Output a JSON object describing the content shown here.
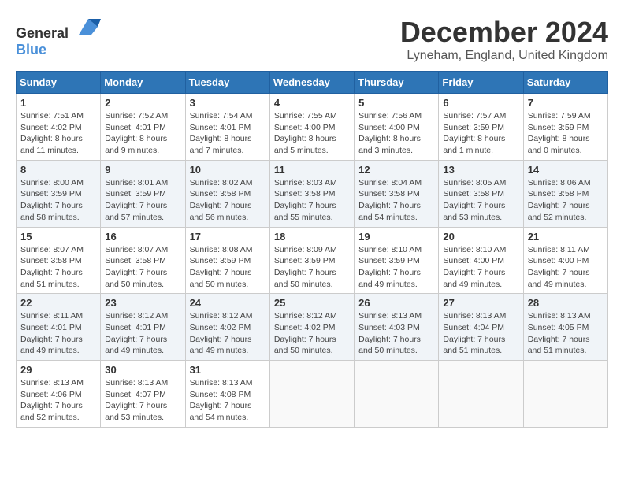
{
  "header": {
    "logo_general": "General",
    "logo_blue": "Blue",
    "month": "December 2024",
    "location": "Lyneham, England, United Kingdom"
  },
  "weekdays": [
    "Sunday",
    "Monday",
    "Tuesday",
    "Wednesday",
    "Thursday",
    "Friday",
    "Saturday"
  ],
  "weeks": [
    [
      {
        "day": "1",
        "sunrise": "7:51 AM",
        "sunset": "4:02 PM",
        "daylight": "8 hours and 11 minutes."
      },
      {
        "day": "2",
        "sunrise": "7:52 AM",
        "sunset": "4:01 PM",
        "daylight": "8 hours and 9 minutes."
      },
      {
        "day": "3",
        "sunrise": "7:54 AM",
        "sunset": "4:01 PM",
        "daylight": "8 hours and 7 minutes."
      },
      {
        "day": "4",
        "sunrise": "7:55 AM",
        "sunset": "4:00 PM",
        "daylight": "8 hours and 5 minutes."
      },
      {
        "day": "5",
        "sunrise": "7:56 AM",
        "sunset": "4:00 PM",
        "daylight": "8 hours and 3 minutes."
      },
      {
        "day": "6",
        "sunrise": "7:57 AM",
        "sunset": "3:59 PM",
        "daylight": "8 hours and 1 minute."
      },
      {
        "day": "7",
        "sunrise": "7:59 AM",
        "sunset": "3:59 PM",
        "daylight": "8 hours and 0 minutes."
      }
    ],
    [
      {
        "day": "8",
        "sunrise": "8:00 AM",
        "sunset": "3:59 PM",
        "daylight": "7 hours and 58 minutes."
      },
      {
        "day": "9",
        "sunrise": "8:01 AM",
        "sunset": "3:59 PM",
        "daylight": "7 hours and 57 minutes."
      },
      {
        "day": "10",
        "sunrise": "8:02 AM",
        "sunset": "3:58 PM",
        "daylight": "7 hours and 56 minutes."
      },
      {
        "day": "11",
        "sunrise": "8:03 AM",
        "sunset": "3:58 PM",
        "daylight": "7 hours and 55 minutes."
      },
      {
        "day": "12",
        "sunrise": "8:04 AM",
        "sunset": "3:58 PM",
        "daylight": "7 hours and 54 minutes."
      },
      {
        "day": "13",
        "sunrise": "8:05 AM",
        "sunset": "3:58 PM",
        "daylight": "7 hours and 53 minutes."
      },
      {
        "day": "14",
        "sunrise": "8:06 AM",
        "sunset": "3:58 PM",
        "daylight": "7 hours and 52 minutes."
      }
    ],
    [
      {
        "day": "15",
        "sunrise": "8:07 AM",
        "sunset": "3:58 PM",
        "daylight": "7 hours and 51 minutes."
      },
      {
        "day": "16",
        "sunrise": "8:07 AM",
        "sunset": "3:58 PM",
        "daylight": "7 hours and 50 minutes."
      },
      {
        "day": "17",
        "sunrise": "8:08 AM",
        "sunset": "3:59 PM",
        "daylight": "7 hours and 50 minutes."
      },
      {
        "day": "18",
        "sunrise": "8:09 AM",
        "sunset": "3:59 PM",
        "daylight": "7 hours and 50 minutes."
      },
      {
        "day": "19",
        "sunrise": "8:10 AM",
        "sunset": "3:59 PM",
        "daylight": "7 hours and 49 minutes."
      },
      {
        "day": "20",
        "sunrise": "8:10 AM",
        "sunset": "4:00 PM",
        "daylight": "7 hours and 49 minutes."
      },
      {
        "day": "21",
        "sunrise": "8:11 AM",
        "sunset": "4:00 PM",
        "daylight": "7 hours and 49 minutes."
      }
    ],
    [
      {
        "day": "22",
        "sunrise": "8:11 AM",
        "sunset": "4:01 PM",
        "daylight": "7 hours and 49 minutes."
      },
      {
        "day": "23",
        "sunrise": "8:12 AM",
        "sunset": "4:01 PM",
        "daylight": "7 hours and 49 minutes."
      },
      {
        "day": "24",
        "sunrise": "8:12 AM",
        "sunset": "4:02 PM",
        "daylight": "7 hours and 49 minutes."
      },
      {
        "day": "25",
        "sunrise": "8:12 AM",
        "sunset": "4:02 PM",
        "daylight": "7 hours and 50 minutes."
      },
      {
        "day": "26",
        "sunrise": "8:13 AM",
        "sunset": "4:03 PM",
        "daylight": "7 hours and 50 minutes."
      },
      {
        "day": "27",
        "sunrise": "8:13 AM",
        "sunset": "4:04 PM",
        "daylight": "7 hours and 51 minutes."
      },
      {
        "day": "28",
        "sunrise": "8:13 AM",
        "sunset": "4:05 PM",
        "daylight": "7 hours and 51 minutes."
      }
    ],
    [
      {
        "day": "29",
        "sunrise": "8:13 AM",
        "sunset": "4:06 PM",
        "daylight": "7 hours and 52 minutes."
      },
      {
        "day": "30",
        "sunrise": "8:13 AM",
        "sunset": "4:07 PM",
        "daylight": "7 hours and 53 minutes."
      },
      {
        "day": "31",
        "sunrise": "8:13 AM",
        "sunset": "4:08 PM",
        "daylight": "7 hours and 54 minutes."
      },
      null,
      null,
      null,
      null
    ]
  ]
}
